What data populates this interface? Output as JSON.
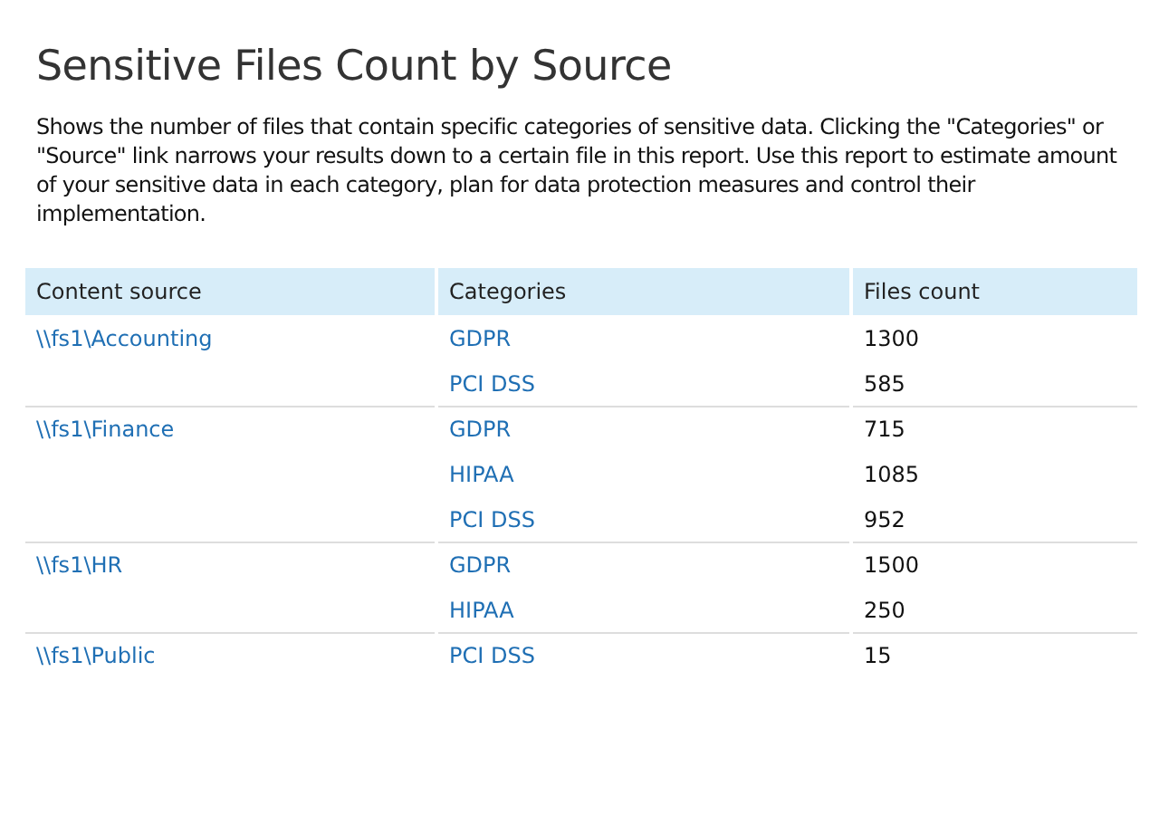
{
  "title": "Sensitive Files Count by Source",
  "description": "Shows the number of files that contain specific categories of sensitive data. Clicking the \"Categories\" or \"Source\" link narrows your results down to a certain file in this report. Use this report to estimate amount of your sensitive data in each category, plan for data protection measures and control their implementation.",
  "table": {
    "columns": [
      "Content source",
      "Categories",
      "Files count"
    ],
    "groups": [
      {
        "source": "\\\\fs1\\Accounting",
        "rows": [
          {
            "category": "GDPR",
            "count": "1300"
          },
          {
            "category": "PCI DSS",
            "count": "585"
          }
        ]
      },
      {
        "source": "\\\\fs1\\Finance",
        "rows": [
          {
            "category": "GDPR",
            "count": "715"
          },
          {
            "category": "HIPAA",
            "count": "1085"
          },
          {
            "category": "PCI DSS",
            "count": "952"
          }
        ]
      },
      {
        "source": "\\\\fs1\\HR",
        "rows": [
          {
            "category": "GDPR",
            "count": "1500"
          },
          {
            "category": "HIPAA",
            "count": "250"
          }
        ]
      },
      {
        "source": "\\\\fs1\\Public",
        "rows": [
          {
            "category": "PCI DSS",
            "count": "15"
          }
        ]
      }
    ]
  }
}
